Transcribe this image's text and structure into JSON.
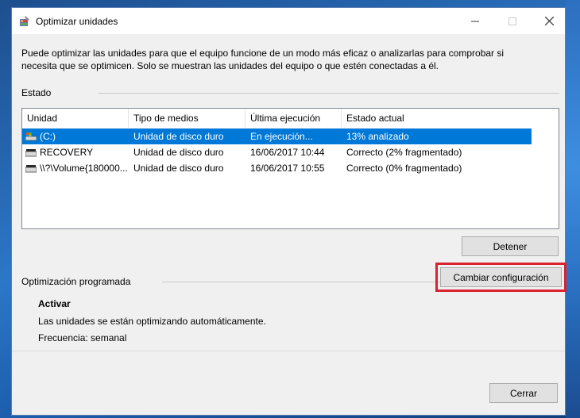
{
  "window": {
    "title": "Optimizar unidades"
  },
  "description": "Puede optimizar las unidades para que el equipo funcione de un modo más eficaz o analizarlas para comprobar si necesita que se optimicen. Solo se muestran las unidades del equipo o que estén conectadas a él.",
  "status_section": {
    "label": "Estado",
    "columns": [
      "Unidad",
      "Tipo de medios",
      "Última ejecución",
      "Estado actual"
    ],
    "rows": [
      {
        "drive": "(C:)",
        "media": "Unidad de disco duro",
        "last_run": "En ejecución...",
        "status": "13% analizado",
        "selected": true,
        "icon": "system-drive-icon"
      },
      {
        "drive": "RECOVERY",
        "media": "Unidad de disco duro",
        "last_run": "16/06/2017 10:44",
        "status": "Correcto (2% fragmentado)",
        "selected": false,
        "icon": "hard-drive-icon"
      },
      {
        "drive": "\\\\?\\Volume{180000...",
        "media": "Unidad de disco duro",
        "last_run": "16/06/2017 10:55",
        "status": "Correcto (0% fragmentado)",
        "selected": false,
        "icon": "hard-drive-icon"
      }
    ],
    "stop_button": "Detener"
  },
  "scheduled": {
    "label": "Optimización programada",
    "state": "Activar",
    "info": "Las unidades se están optimizando automáticamente.",
    "frequency": "Frecuencia: semanal",
    "change_button": "Cambiar configuración"
  },
  "footer": {
    "close_button": "Cerrar"
  },
  "colors": {
    "selection": "#0078d7",
    "highlight": "#d9232e"
  }
}
